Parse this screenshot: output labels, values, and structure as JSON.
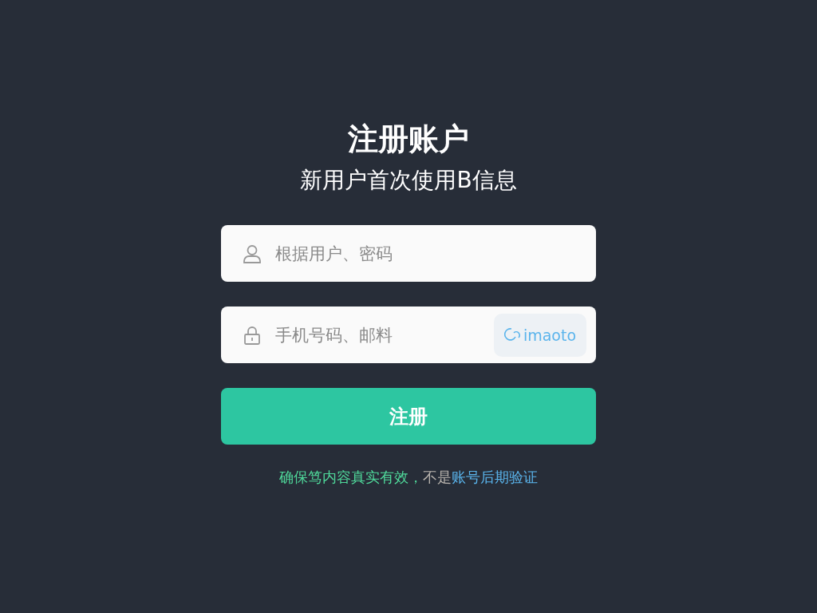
{
  "title": "注册账户",
  "subtitle": "新用户首次使用B信息",
  "fields": [
    {
      "kind": "user",
      "placeholder": "根据用户、密码"
    },
    {
      "kind": "lock",
      "placeholder": "手机号码、邮料",
      "code": "imaoto"
    }
  ],
  "submit": "注册",
  "footer": [
    {
      "text": "确保笃内容真实有效，",
      "color": "#4fd89a"
    },
    {
      "text": "不是",
      "color": "#b9b4ae"
    },
    {
      "text": "账号后期验证",
      "color": "#5ab4ec"
    }
  ]
}
